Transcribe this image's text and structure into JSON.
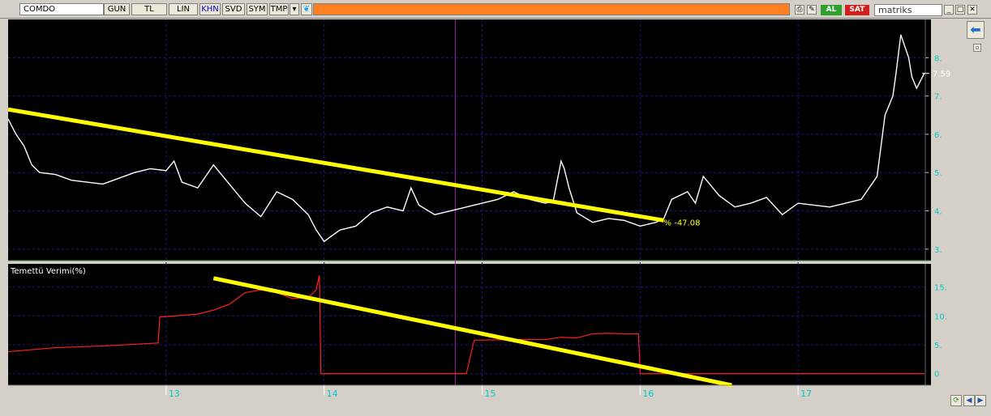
{
  "toolbar": {
    "symbol": "COMDO",
    "buttons": [
      "GUN",
      "TL",
      "LIN",
      "KHN",
      "SVD",
      "SYM",
      "TMP"
    ],
    "active_button": "KHN",
    "buy_label": "AL",
    "sell_label": "SAT",
    "brand": "matriks"
  },
  "colors": {
    "background": "#000000",
    "price_line": "#ffffff",
    "dividend_line": "#ff2020",
    "trendline": "#ffff00",
    "grid": "#1a1a8c",
    "axis_text": "#00c8c8",
    "cursor": "#a020a0"
  },
  "chart_data": [
    {
      "type": "line",
      "panel": "price",
      "x_ticks": [
        "13",
        "14",
        "15",
        "16",
        "17"
      ],
      "y_ticks": [
        "3.",
        "4.",
        "5.",
        "6.",
        "7.",
        "8."
      ],
      "ylim": [
        2.7,
        9.0
      ],
      "last_value_label": "7.59",
      "trendline_label": "% -47.08",
      "trendline": {
        "x": [
          12.0,
          16.15
        ],
        "y": [
          6.65,
          3.75
        ]
      },
      "series": [
        {
          "x": [
            12.0,
            12.05,
            12.1,
            12.15,
            12.2,
            12.3,
            12.4,
            12.5,
            12.6,
            12.7,
            12.8,
            12.9,
            13.0,
            13.05,
            13.1,
            13.2,
            13.3,
            13.4,
            13.5,
            13.6,
            13.7,
            13.8,
            13.85,
            13.9,
            13.95,
            14.0,
            14.1,
            14.2,
            14.3,
            14.4,
            14.5,
            14.55,
            14.6,
            14.7,
            14.8,
            14.9,
            15.0,
            15.1,
            15.2,
            15.3,
            15.4,
            15.45,
            15.5,
            15.52,
            15.55,
            15.6,
            15.7,
            15.8,
            15.9,
            16.0,
            16.1,
            16.15,
            16.2,
            16.3,
            16.35,
            16.4,
            16.5,
            16.6,
            16.7,
            16.8,
            16.9,
            17.0,
            17.1,
            17.2,
            17.3,
            17.4,
            17.5,
            17.55,
            17.6,
            17.62,
            17.65,
            17.7,
            17.72,
            17.75,
            17.8
          ],
          "y": [
            6.4,
            6.0,
            5.7,
            5.2,
            5.0,
            4.95,
            4.8,
            4.75,
            4.7,
            4.85,
            5.0,
            5.1,
            5.05,
            5.3,
            4.75,
            4.6,
            5.2,
            4.7,
            4.2,
            3.85,
            4.5,
            4.3,
            4.1,
            3.9,
            3.5,
            3.2,
            3.5,
            3.6,
            3.95,
            4.1,
            4.0,
            4.6,
            4.15,
            3.9,
            4.0,
            4.1,
            4.2,
            4.3,
            4.5,
            4.3,
            4.2,
            4.25,
            5.3,
            5.1,
            4.6,
            3.95,
            3.7,
            3.8,
            3.75,
            3.6,
            3.7,
            3.8,
            4.3,
            4.5,
            4.2,
            4.9,
            4.4,
            4.1,
            4.2,
            4.35,
            3.9,
            4.2,
            4.15,
            4.1,
            4.2,
            4.3,
            4.9,
            6.5,
            7.0,
            7.6,
            8.6,
            8.0,
            7.5,
            7.2,
            7.6
          ],
          "color": "#ffffff"
        }
      ]
    },
    {
      "type": "line",
      "panel": "indicator",
      "title": "Temettü Verimi(%)",
      "y_ticks": [
        "0",
        "5.",
        "10.",
        "15."
      ],
      "ylim": [
        -2.0,
        19.0
      ],
      "trendline": {
        "x": [
          13.3,
          16.58
        ],
        "y": [
          16.5,
          -2.0
        ]
      },
      "series": [
        {
          "x": [
            12.0,
            12.3,
            12.6,
            12.95,
            12.96,
            13.2,
            13.3,
            13.4,
            13.5,
            13.6,
            13.7,
            13.8,
            13.9,
            13.95,
            13.97,
            13.98,
            14.0,
            14.5,
            14.9,
            14.95,
            15.2,
            15.4,
            15.5,
            15.6,
            15.7,
            15.8,
            15.9,
            15.99,
            16.0,
            16.5,
            17.0,
            17.5,
            17.8
          ],
          "y": [
            3.8,
            4.5,
            4.8,
            5.3,
            9.8,
            10.3,
            11.0,
            12.0,
            14.0,
            14.5,
            14.0,
            13.0,
            13.2,
            14.5,
            17.0,
            0.0,
            0.0,
            0.0,
            0.0,
            5.8,
            5.9,
            5.9,
            6.3,
            6.2,
            6.9,
            7.0,
            6.9,
            6.9,
            0.0,
            0.0,
            0.0,
            0.0,
            0.0
          ],
          "color": "#ff2020"
        }
      ]
    }
  ]
}
